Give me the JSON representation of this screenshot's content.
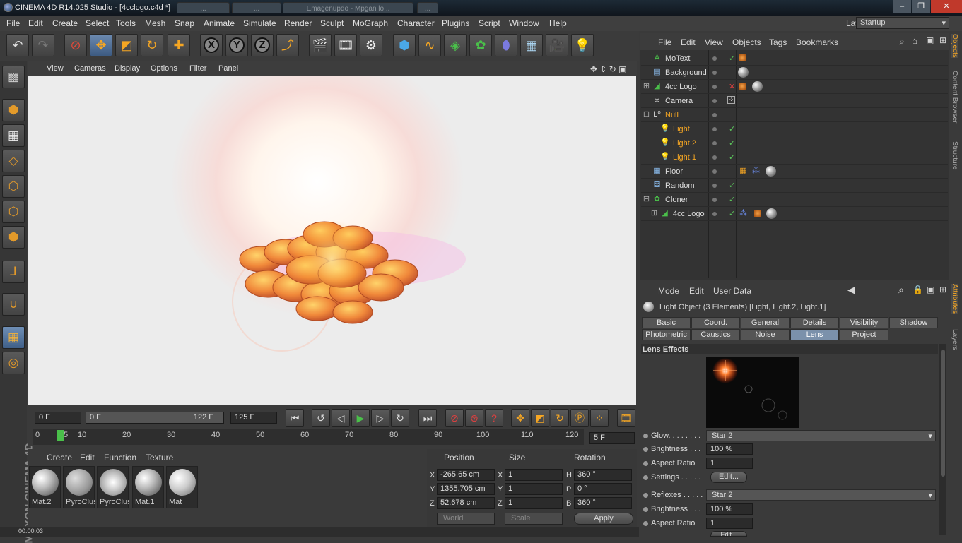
{
  "window": {
    "title": "CINEMA 4D R14.025 Studio - [4cclogo.c4d *]",
    "bg_tabs": [
      "...",
      "...",
      "Emagenupdo - Mpgan lo...",
      "..."
    ],
    "buttons": [
      "–",
      "❐",
      "✕"
    ]
  },
  "menu": [
    "File",
    "Edit",
    "Create",
    "Select",
    "Tools",
    "Mesh",
    "Snap",
    "Animate",
    "Simulate",
    "Render",
    "Sculpt",
    "MoGraph",
    "Character",
    "Plugins",
    "Script",
    "Window",
    "Help"
  ],
  "layout": {
    "label": "Layout:",
    "value": "Startup"
  },
  "toolbar": [
    "undo",
    "redo",
    "live-selection",
    "move",
    "scale",
    "rotate",
    "last-tool",
    "x-axis",
    "y-axis",
    "z-axis",
    "world-coordinates",
    "render-view",
    "render-picture-viewer",
    "render-settings",
    "cube",
    "spline-pen",
    "subdivision-surface",
    "cloner",
    "deformer",
    "floor",
    "camera",
    "light"
  ],
  "axes": {
    "x": "X",
    "y": "Y",
    "z": "Z"
  },
  "viewport_menu": [
    "View",
    "Cameras",
    "Display",
    "Options",
    "Filter",
    "Panel"
  ],
  "timeline": {
    "current_frame": "0 F",
    "range_start": "0 F",
    "range_end": "122 F",
    "max_frame": "125 F",
    "frame_field": "5 F",
    "ruler_marks": [
      "0",
      "5",
      "10",
      "20",
      "30",
      "40",
      "50",
      "60",
      "70",
      "80",
      "90",
      "100",
      "110",
      "120"
    ],
    "playhead_frame": 5
  },
  "material_manager": {
    "menu": [
      "Create",
      "Edit",
      "Function",
      "Texture"
    ],
    "materials": [
      "Mat.2",
      "PyroClus",
      "PyroClus",
      "Mat.1",
      "Mat"
    ]
  },
  "coordinates": {
    "headers": [
      "Position",
      "Size",
      "Rotation"
    ],
    "rows": [
      {
        "axis": "X",
        "pos": "-265.65 cm",
        "size_axis": "X",
        "size": "1",
        "rot_axis": "H",
        "rot": "360 °"
      },
      {
        "axis": "Y",
        "pos": "1355.705 cm",
        "size_axis": "Y",
        "size": "1",
        "rot_axis": "P",
        "rot": "0 °"
      },
      {
        "axis": "Z",
        "pos": "52.678 cm",
        "size_axis": "Z",
        "size": "1",
        "rot_axis": "B",
        "rot": "360 °"
      }
    ],
    "mode": "World",
    "size_mode": "Scale",
    "apply": "Apply"
  },
  "status": "00:00:03",
  "object_manager": {
    "menu": [
      "File",
      "Edit",
      "View",
      "Objects",
      "Tags",
      "Bookmarks"
    ],
    "objects": [
      {
        "name": "MoText",
        "icon": "motext-icon",
        "indent": 0,
        "selected": false,
        "check": true,
        "tags": [
          "orange"
        ]
      },
      {
        "name": "Background",
        "icon": "background-icon",
        "indent": 0,
        "selected": false,
        "check": false,
        "tags": [
          "ball"
        ]
      },
      {
        "name": "4cc Logo",
        "icon": "extrude-icon",
        "indent": 0,
        "selected": false,
        "check": false,
        "x": true,
        "tags": [
          "orange",
          "ball"
        ]
      },
      {
        "name": "Camera",
        "icon": "camera-icon",
        "indent": 0,
        "selected": false,
        "check": false,
        "tags": [
          "target"
        ]
      },
      {
        "name": "Null",
        "icon": "null-icon",
        "indent": 0,
        "selected": true,
        "check": false,
        "tags": []
      },
      {
        "name": "Light",
        "icon": "light-icon",
        "indent": 1,
        "selected": true,
        "check": true,
        "tags": []
      },
      {
        "name": "Light.2",
        "icon": "light-icon",
        "indent": 1,
        "selected": true,
        "check": true,
        "tags": []
      },
      {
        "name": "Light.1",
        "icon": "light-icon",
        "indent": 1,
        "selected": true,
        "check": true,
        "tags": []
      },
      {
        "name": "Floor",
        "icon": "floor-icon",
        "indent": 0,
        "selected": false,
        "check": false,
        "tags": [
          "compositing",
          "multi",
          "ball"
        ]
      },
      {
        "name": "Random",
        "icon": "random-icon",
        "indent": 0,
        "selected": false,
        "check": true,
        "tags": []
      },
      {
        "name": "Cloner",
        "icon": "cloner-icon",
        "indent": 0,
        "selected": false,
        "check": true,
        "tags": []
      },
      {
        "name": "4cc Logo",
        "icon": "extrude-icon",
        "indent": 1,
        "selected": false,
        "check": true,
        "tags": [
          "multi",
          "orange",
          "ball"
        ]
      }
    ]
  },
  "side_tabs_top": [
    "Objects",
    "Content Browser",
    "Structure"
  ],
  "side_tabs_bottom": [
    "Attributes",
    "Layers"
  ],
  "attributes": {
    "menu": [
      "Mode",
      "Edit",
      "User Data"
    ],
    "title": "Light Object (3 Elements) [Light, Light.2, Light.1]",
    "tabs_row1": [
      "Basic",
      "Coord.",
      "General",
      "Details",
      "Visibility",
      "Shadow"
    ],
    "tabs_row2": [
      "Photometric",
      "Caustics",
      "Noise",
      "Lens",
      "Project"
    ],
    "active_tab": "Lens",
    "section": "Lens Effects",
    "glow_label": "Glow. . . . . . . .",
    "glow_value": "Star 2",
    "brightness_label": "Brightness . . .",
    "brightness_value": "100 %",
    "aspect_label": "Aspect Ratio",
    "aspect_value": "1",
    "settings_label": "Settings . . . . .",
    "edit_btn": "Edit...",
    "reflexes_label": "Reflexes . . . . .",
    "reflexes_value": "Star 2",
    "brightness2_value": "100 %",
    "aspect2_value": "1"
  }
}
